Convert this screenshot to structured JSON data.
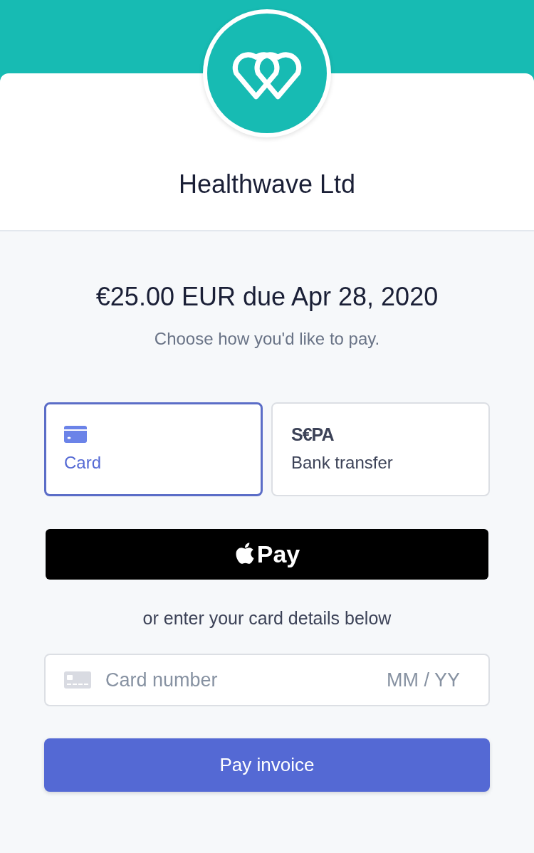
{
  "header": {
    "merchant_name": "Healthwave Ltd"
  },
  "invoice": {
    "amount_due": "€25.00 EUR due Apr 28, 2020",
    "prompt": "Choose how you'd like to pay."
  },
  "payment_methods": [
    {
      "kind": "card",
      "label": "Card",
      "selected": true
    },
    {
      "kind": "sepa",
      "logo_text": "S€PA",
      "label": "Bank transfer",
      "selected": false
    }
  ],
  "wallet_button": {
    "label": "Pay"
  },
  "divider_text": "or enter your card details below",
  "card_field": {
    "placeholder": "Card number",
    "expiry_placeholder": "MM / YY"
  },
  "submit_button": {
    "label": "Pay invoice"
  }
}
